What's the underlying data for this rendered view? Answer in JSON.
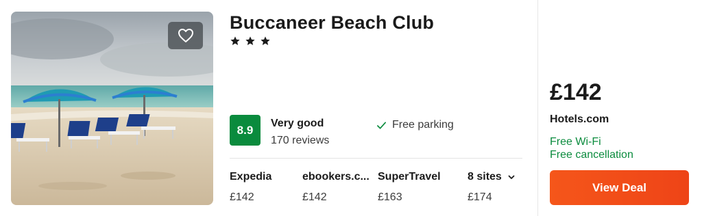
{
  "hotel": {
    "name": "Buccaneer Beach Club",
    "star_count": 3,
    "stars_icon": "star-icon",
    "favorite_icon": "heart-icon"
  },
  "rating": {
    "score": "8.9",
    "label": "Very good",
    "reviews": "170 reviews",
    "badge_color": "#0a8b3d"
  },
  "amenities": [
    {
      "icon": "check-icon",
      "label": "Free parking"
    }
  ],
  "sites": [
    {
      "name": "Expedia",
      "price": "£142"
    },
    {
      "name": "ebookers.c...",
      "price": "£142"
    },
    {
      "name": "SuperTravel",
      "price": "£163"
    }
  ],
  "more_sites": {
    "label": "8 sites",
    "price": "£174",
    "icon": "chevron-down-icon"
  },
  "deal": {
    "price": "£142",
    "site": "Hotels.com",
    "features": [
      "Free Wi-Fi",
      "Free cancellation"
    ],
    "button_label": "View Deal",
    "button_color": "#f04a17",
    "feature_color": "#0a8b3d"
  }
}
